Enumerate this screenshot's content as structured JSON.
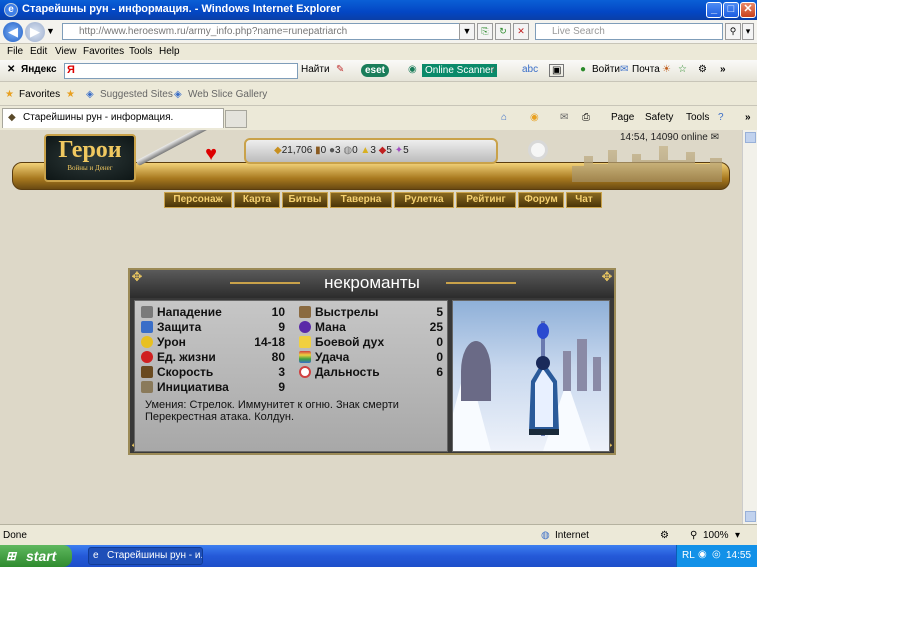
{
  "window": {
    "title": "Старейшны рун - информация. - Windows Internet Explorer",
    "url": "http://www.heroeswm.ru/army_info.php?name=runepatriarch",
    "search_placeholder": "Live Search"
  },
  "menu": [
    "File",
    "Edit",
    "View",
    "Favorites",
    "Tools",
    "Help"
  ],
  "yandex_bar": {
    "brand": "Яндекс",
    "find_label": "Найти",
    "eset_label": "eset",
    "scanner_label": "Online Scanner",
    "login_label": "Войти",
    "mail_label": "Почта"
  },
  "favorites_bar": {
    "favorites_label": "Favorites",
    "suggested_label": "Suggested Sites",
    "webslice_label": "Web Slice Gallery"
  },
  "tab": {
    "label": "Старейшины рун - информация."
  },
  "command_bar": {
    "page": "Page",
    "safety": "Safety",
    "tools": "Tools"
  },
  "game": {
    "logo_title": "Герои",
    "logo_subtitle": "Войны и Денег",
    "online_text": "14:54, 14090 online",
    "resources": [
      {
        "icon": "gold-icon",
        "value": "21,706"
      },
      {
        "icon": "wood-icon",
        "value": "0"
      },
      {
        "icon": "ore-icon",
        "value": "3"
      },
      {
        "icon": "mercury-icon",
        "value": "0"
      },
      {
        "icon": "sulfur-icon",
        "value": "3"
      },
      {
        "icon": "crystal-icon",
        "value": "5"
      },
      {
        "icon": "gems-icon",
        "value": "5"
      }
    ],
    "nav": [
      "Персонаж",
      "Карта",
      "Битвы",
      "Таверна",
      "Рулетка",
      "Рейтинг",
      "Форум",
      "Чат"
    ]
  },
  "unit": {
    "title": "некроманты",
    "stats_left": [
      {
        "label": "Нападение",
        "value": "10",
        "color": "#7a7a7a"
      },
      {
        "label": "Защита",
        "value": "9",
        "color": "#3a6ec8"
      },
      {
        "label": "Урон",
        "value": "14-18",
        "color": "#e8c020"
      },
      {
        "label": "Ед. жизни",
        "value": "80",
        "color": "#d02020"
      },
      {
        "label": "Скорость",
        "value": "3",
        "color": "#6a4a20"
      },
      {
        "label": "Инициатива",
        "value": "9",
        "color": "#8a7a5a"
      }
    ],
    "stats_right": [
      {
        "label": "Выстрелы",
        "value": "5",
        "color": "#8a6a40"
      },
      {
        "label": "Мана",
        "value": "25",
        "color": "#5a2aa8"
      },
      {
        "label": "Боевой дух",
        "value": "0",
        "color": "#f0d040"
      },
      {
        "label": "Удача",
        "value": "0",
        "color": "#40a040"
      },
      {
        "label": "Дальность",
        "value": "6",
        "color": "#d04040"
      }
    ],
    "skills_text": "Умения: Стрелок. Иммунитет к огню. Знак смерти Перекрестная атака. Колдун."
  },
  "status": {
    "left": "Done",
    "zone": "Internet",
    "zoom": "100%"
  },
  "taskbar": {
    "start": "start",
    "task": "Старейшины рун - и...",
    "lang": "RL",
    "clock": "14:55"
  }
}
